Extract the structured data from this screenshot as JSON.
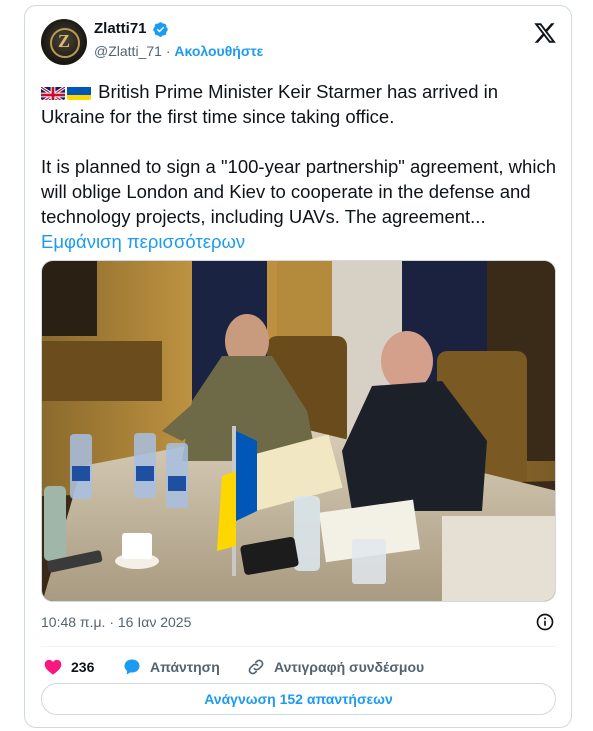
{
  "author": {
    "name": "Zlatti71",
    "handle": "@Zlatti_71",
    "separator": "·",
    "follow_label": "Ακολουθήστε",
    "avatar_letter": "Z"
  },
  "tweet": {
    "paragraph1": "British Prime Minister Keir Starmer has arrived in Ukraine for the first time since taking office.",
    "paragraph2": "It is planned to sign a \"100-year partnership\" agreement, which will oblige London and Kiev to cooperate in the defense and technology projects, including UAVs. The agreement...",
    "show_more_label": "Εμφάνιση περισσότερων",
    "flags": [
      "uk-flag",
      "ukraine-flag"
    ]
  },
  "meta": {
    "timestamp": "10:48 π.μ. · 16 Ιαν 2025"
  },
  "actions": {
    "likes_count": "236",
    "reply_label": "Απάντηση",
    "copy_link_label": "Αντιγραφή συνδέσμου"
  },
  "read_replies_label": "Ανάγνωση 152 απαντήσεων",
  "colors": {
    "accent": "#1d9bf0",
    "like": "#f91880",
    "text": "#0f1419",
    "muted": "#536471",
    "border": "#cfd9de"
  }
}
